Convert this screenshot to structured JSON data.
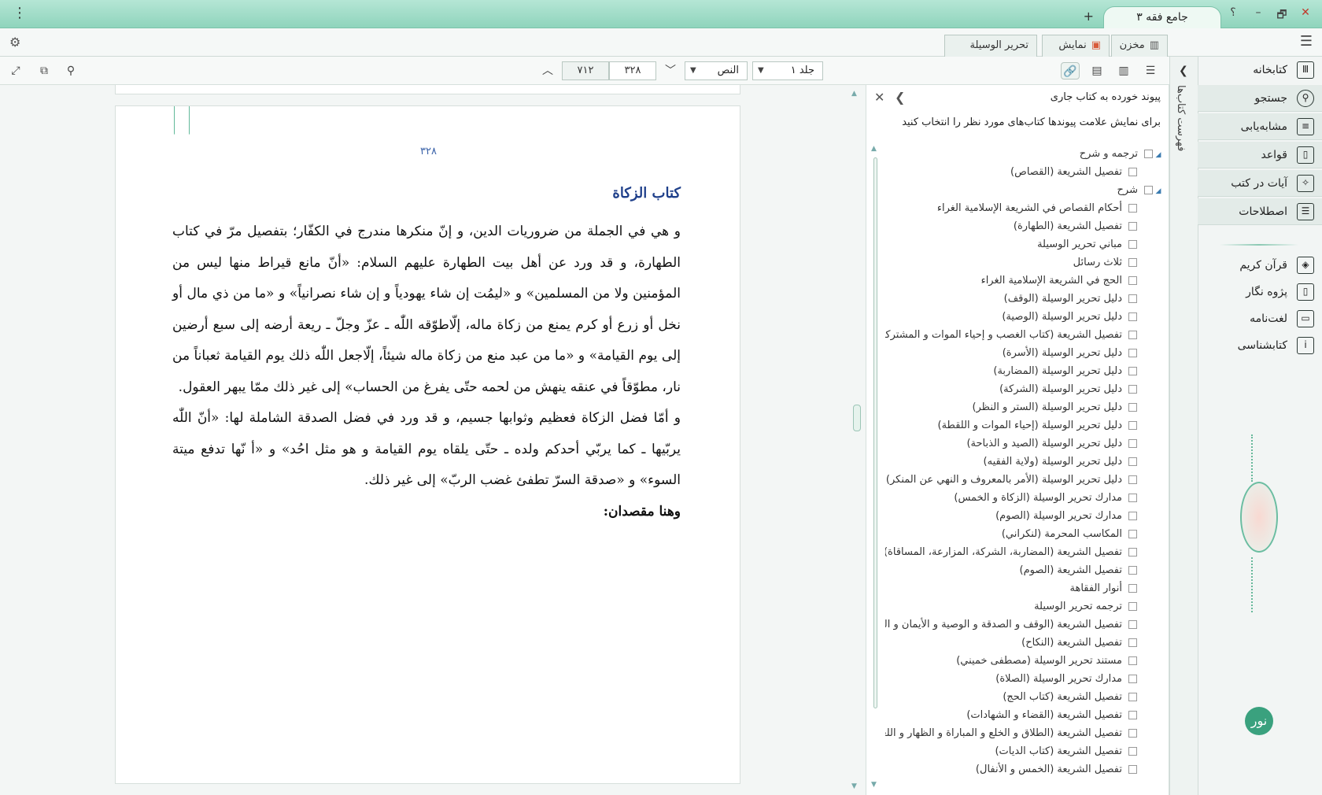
{
  "window": {
    "tab_title": "جامع فقه ۳",
    "help": "؟",
    "minimize": "–",
    "restore": "🗗",
    "close": "✕",
    "new_tab": "+",
    "menu": "⋮"
  },
  "tabs": {
    "storage": "مخزن",
    "display": "نمایش",
    "document": "تحریر الوسیلة"
  },
  "nav": {
    "items": [
      {
        "label": "کتابخانه",
        "icon": "library-icon"
      },
      {
        "label": "جستجو",
        "icon": "search-icon"
      },
      {
        "label": "مشابه‌یابی",
        "icon": "similar-icon"
      },
      {
        "label": "قواعد",
        "icon": "rules-icon"
      },
      {
        "label": "آیات در کتب",
        "icon": "verses-icon"
      },
      {
        "label": "اصطلاحات",
        "icon": "terms-icon"
      },
      {
        "label": "قرآن کریم",
        "icon": "quran-icon"
      },
      {
        "label": "پژوه نگار",
        "icon": "notes-icon"
      },
      {
        "label": "لغت‌نامه",
        "icon": "dictionary-icon"
      },
      {
        "label": "کتابشناسی",
        "icon": "bibliography-icon"
      }
    ],
    "vertical_tab": "فهرست کتاب‌ها",
    "logo": "نور"
  },
  "toolbar": {
    "volume": "جلد ۱",
    "view_mode": "النص",
    "current_page": "۳۲۸",
    "total_pages": "۷۱۲"
  },
  "links_panel": {
    "title": "پیوند خورده به کتاب جاری",
    "subtitle": "برای نمایش علامت پیوندها کتاب‌های مورد نظر را انتخاب کنید",
    "groups": [
      {
        "label": "ترجمه و شرح",
        "items": [
          "تفصيل الشريعة (القصاص)"
        ]
      },
      {
        "label": "شرح",
        "items": [
          "أحكام القصاص في الشريعة الإسلامية الغراء",
          "تفصيل الشريعة (الطهارة)",
          "مباني تحرير الوسيلة",
          "ثلاث رسائل",
          "الحج في الشريعة الإسلامية الغراء",
          "دليل تحرير الوسيلة (الوقف)",
          "دليل تحرير الوسيلة (الوصية)",
          "تفصيل الشريعة (كتاب الغصب و إحياء الموات و المشتركات)",
          "دليل تحرير الوسيلة (الأسرة)",
          "دليل تحرير الوسيلة (المضاربة)",
          "دليل تحرير الوسيلة (الشركة)",
          "دليل تحرير الوسيلة (الستر و النظر)",
          "دليل تحرير الوسيلة (إحياء الموات و اللقطة)",
          "دليل تحرير الوسيلة (الصيد و الذباحة)",
          "دليل تحرير الوسيلة (ولاية الفقيه)",
          "دليل تحرير الوسيلة (الأمر بالمعروف و النهي عن المنكر)",
          "مدارك تحرير الوسيلة (الزكاة و الخمس)",
          "مدارك تحرير الوسيلة (الصوم)",
          "المكاسب المحرمة (لنكراني)",
          "تفصيل الشريعة (المضاربة، الشركة، المزارعة، المساقاة)",
          "تفصيل الشريعة (الصوم)",
          "أنوار الفقاهة",
          "ترجمه تحرير الوسيلة",
          "تفصيل الشريعة (الوقف و الصدقة و الوصية و الأيمان و النذور)",
          "تفصيل الشريعة (النكاح)",
          "مستند تحرير الوسيلة (مصطفى خميني)",
          "مدارك تحرير الوسيلة (الصلاة)",
          "تفصيل الشريعة (كتاب الحج)",
          "تفصيل الشريعة (القضاء و الشهادات)",
          "تفصيل الشريعة (الطلاق و الخلع و المباراة و الظهار و اللعان)",
          "تفصيل الشريعة (كتاب الديات)",
          "تفصيل الشريعة (الخمس و الأنفال)"
        ]
      }
    ]
  },
  "document": {
    "page_number": "۳۲۸",
    "heading": "كتاب الزكاة",
    "paragraphs": [
      "و هي في الجملة من ضروريات الدين، و إنّ منكرها مندرج في الكفّار؛ بتفصيل مرّ في كتاب الطهارة، و قد ورد عن أهل بيت الطهارة عليهم السلام: «أنّ مانع قيراط منها ليس من المؤمنين ولا من المسلمين» و «ليمُت إن شاء يهودياً و إن شاء نصرانياً» و «ما من ذي مال أو نخل أو زرع أو كرم يمنع من زكاة ماله، إلّاطوّقه اللّٰه ـ عزّ وجلّ ـ ريعة أرضه إلى سبع أرضين إلى يوم القيامة» و «ما من عبد منع من زكاة ماله شيئاً، إلّاجعل اللّٰه ذلك يوم القيامة ثعباناً من نار، مطوّقاً في عنقه ينهش من لحمه حتّى يفرغ من الحساب» إلى غير ذلك ممّا يبهر العقول.",
      "و أمّا فضل الزكاة فعظيم وثوابها جسيم، و قد ورد في فضل الصدقة الشاملة لها: «أنّ اللّٰه يربّيها ـ كما يربّي أحدكم ولده ـ حتّى يلقاه يوم القيامة و هو مثل احُد» و «أ نّها تدفع ميتة السوء» و «صدقة السرّ تطفئ غضب الربّ» إلى غير ذلك."
    ],
    "subheading": "وهنا مقصدان:"
  }
}
